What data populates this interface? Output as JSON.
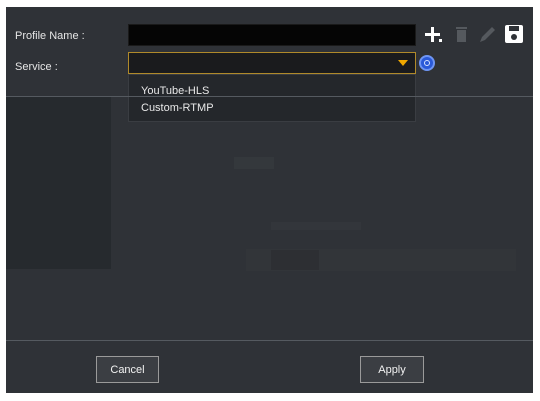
{
  "form": {
    "profile_name_label": "Profile Name :",
    "service_label": "Service :",
    "profile_name_value": "",
    "service_value": ""
  },
  "dropdown": {
    "options": [
      "YouTube-HLS",
      "Custom-RTMP"
    ]
  },
  "toolbar": {
    "icons": [
      "add-icon",
      "delete-icon",
      "edit-icon",
      "save-icon"
    ]
  },
  "buttons": {
    "cancel_label": "Cancel",
    "apply_label": "Apply"
  },
  "colors": {
    "accent_caret": "#f0a800",
    "info_blue": "#2a59d8"
  }
}
